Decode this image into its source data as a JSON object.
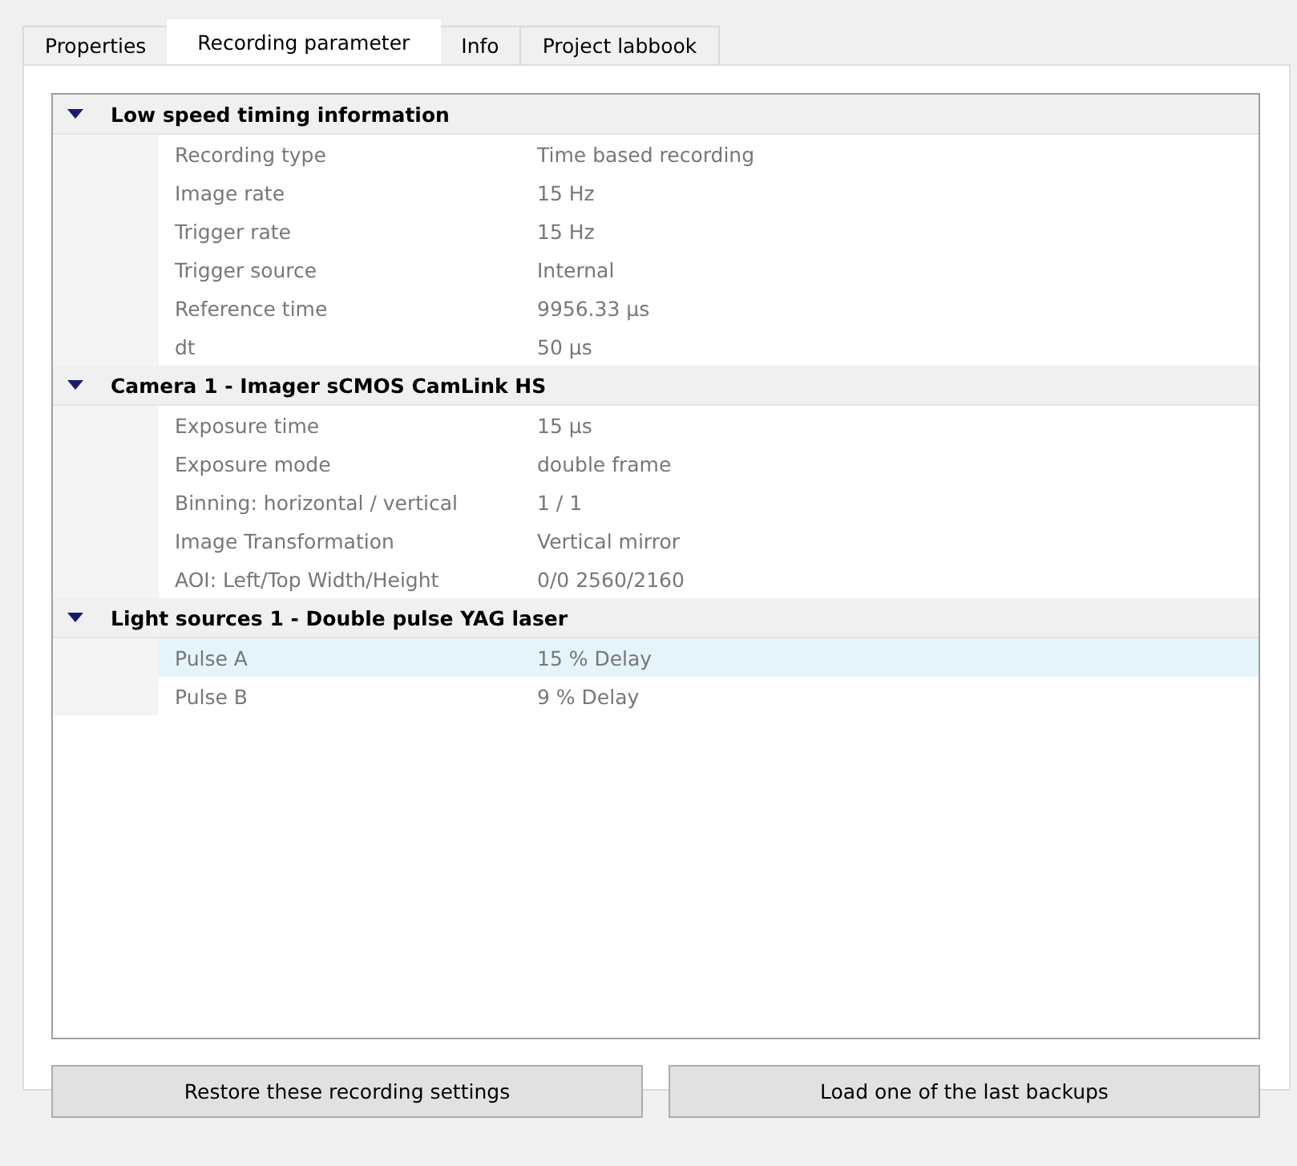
{
  "tabs": [
    {
      "label": "Properties",
      "selected": false
    },
    {
      "label": "Recording parameter",
      "selected": true
    },
    {
      "label": "Info",
      "selected": false
    },
    {
      "label": "Project labbook",
      "selected": false
    }
  ],
  "tree": [
    {
      "title": "Low speed timing information",
      "expanded": true,
      "children": [
        {
          "name": "Recording type",
          "value": "Time based recording",
          "selected": false
        },
        {
          "name": "Image rate",
          "value": "15 Hz",
          "selected": false
        },
        {
          "name": "Trigger rate",
          "value": "15 Hz",
          "selected": false
        },
        {
          "name": "Trigger source",
          "value": "Internal",
          "selected": false
        },
        {
          "name": "Reference time",
          "value": "9956.33 µs",
          "selected": false
        },
        {
          "name": "dt",
          "value": "50 µs",
          "selected": false
        }
      ]
    },
    {
      "title": "Camera 1 - Imager sCMOS CamLink HS",
      "expanded": true,
      "children": [
        {
          "name": "Exposure time",
          "value": "15 µs",
          "selected": false
        },
        {
          "name": "Exposure mode",
          "value": "double frame",
          "selected": false
        },
        {
          "name": "Binning: horizontal / vertical",
          "value": "1 / 1",
          "selected": false
        },
        {
          "name": "Image Transformation",
          "value": "Vertical mirror",
          "selected": false
        },
        {
          "name": "AOI: Left/Top Width/Height",
          "value": "0/0  2560/2160",
          "selected": false
        }
      ]
    },
    {
      "title": "Light sources 1 - Double pulse YAG laser",
      "expanded": true,
      "children": [
        {
          "name": "Pulse A",
          "value": "15 %  Delay",
          "selected": true
        },
        {
          "name": "Pulse B",
          "value": "9 %  Delay",
          "selected": false
        }
      ]
    }
  ],
  "buttons": [
    "Restore these recording settings",
    "Load one of the last backups"
  ]
}
